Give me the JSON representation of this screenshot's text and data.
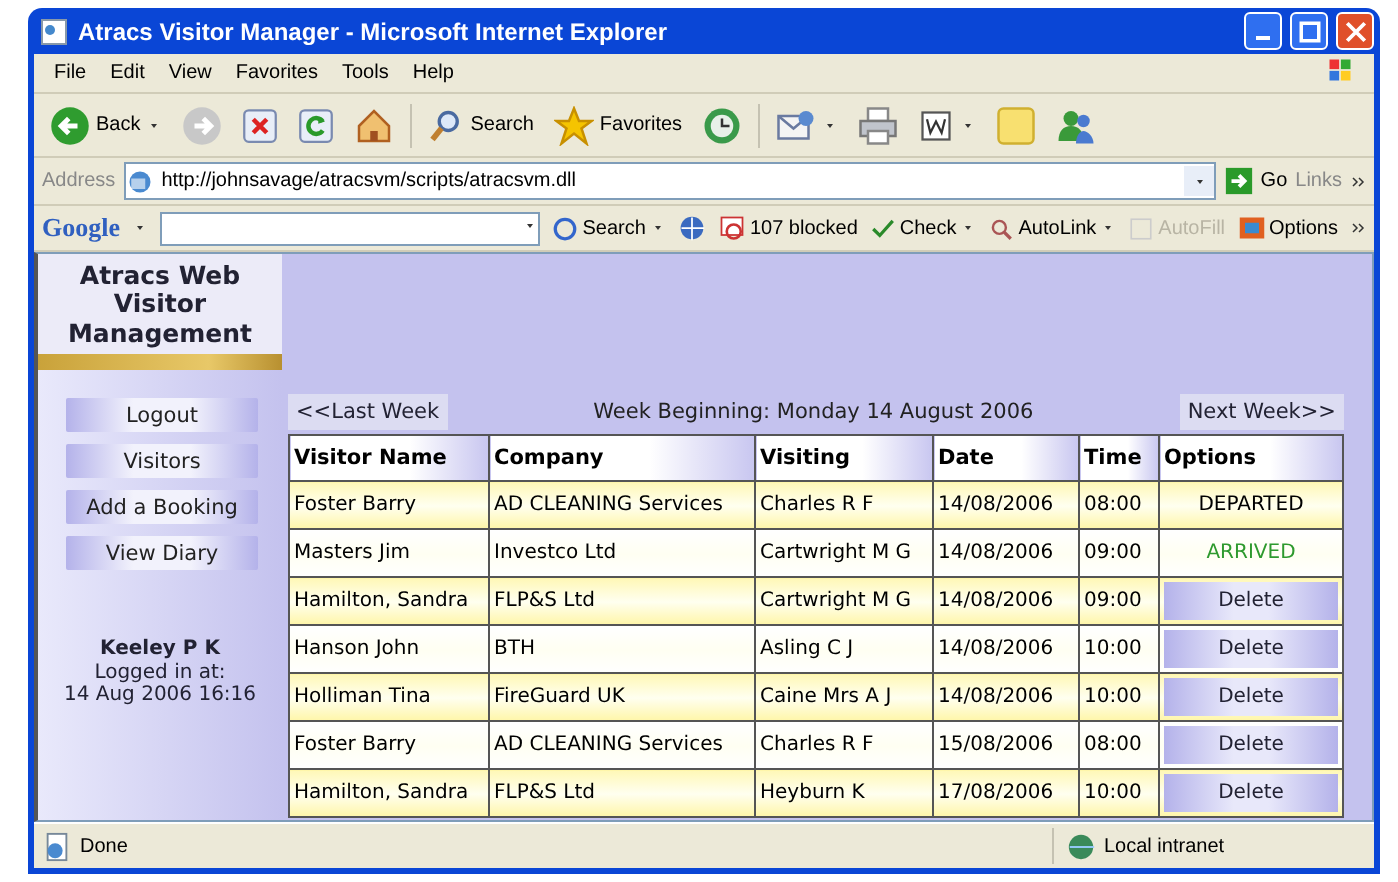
{
  "window": {
    "title": "Atracs Visitor Manager - Microsoft Internet Explorer"
  },
  "menu": [
    "File",
    "Edit",
    "View",
    "Favorites",
    "Tools",
    "Help"
  ],
  "toolbar": [
    {
      "kind": "back",
      "label": "Back"
    },
    {
      "kind": "forward"
    },
    {
      "kind": "stop"
    },
    {
      "kind": "refresh"
    },
    {
      "kind": "home"
    },
    {
      "kind": "search",
      "label": "Search"
    },
    {
      "kind": "favorites",
      "label": "Favorites"
    },
    {
      "kind": "history"
    },
    {
      "kind": "mail"
    },
    {
      "kind": "print"
    },
    {
      "kind": "edit"
    },
    {
      "kind": "notes"
    },
    {
      "kind": "messenger"
    }
  ],
  "address": {
    "label": "Address",
    "value": "http://johnsavage/atracsvm/scripts/atracsvm.dll",
    "go": "Go",
    "links": "Links"
  },
  "google_bar": {
    "logo": "Google",
    "search": "Search",
    "blocked": "107 blocked",
    "check": "Check",
    "autolink": "AutoLink",
    "autofill": {
      "label": "AutoFill",
      "disabled": true
    },
    "options": "Options"
  },
  "sidebar": {
    "title": "Atracs Web Visitor Management",
    "buttons": [
      "Logout",
      "Visitors",
      "Add a Booking",
      "View Diary"
    ],
    "user": "Keeley P K",
    "login_label": "Logged in at:",
    "login_time": "14 Aug 2006 16:16"
  },
  "week_nav": {
    "prev": "<<Last Week",
    "label": "Week Beginning: Monday 14 August 2006",
    "next": "Next Week>>"
  },
  "table": {
    "columns": [
      "Visitor Name",
      "Company",
      "Visiting",
      "Date",
      "Time",
      "Options"
    ],
    "rows": [
      {
        "cells": [
          "Foster Barry",
          "AD CLEANING Services",
          "Charles R F",
          "14/08/2006",
          "08:00"
        ],
        "option": {
          "kind": "status",
          "text": "DEPARTED",
          "color": "#000000"
        }
      },
      {
        "cells": [
          "Masters Jim",
          "Investco Ltd",
          "Cartwright M G",
          "14/08/2006",
          "09:00"
        ],
        "option": {
          "kind": "status",
          "text": "ARRIVED",
          "color": "#2e9a2e"
        }
      },
      {
        "cells": [
          "Hamilton, Sandra",
          "FLP&S Ltd",
          "Cartwright M G",
          "14/08/2006",
          "09:00"
        ],
        "option": {
          "kind": "button",
          "text": "Delete"
        }
      },
      {
        "cells": [
          "Hanson John",
          "BTH",
          "Asling C J",
          "14/08/2006",
          "10:00"
        ],
        "option": {
          "kind": "button",
          "text": "Delete"
        }
      },
      {
        "cells": [
          "Holliman Tina",
          "FireGuard UK",
          "Caine Mrs A J",
          "14/08/2006",
          "10:00"
        ],
        "option": {
          "kind": "button",
          "text": "Delete"
        }
      },
      {
        "cells": [
          "Foster Barry",
          "AD CLEANING Services",
          "Charles R F",
          "15/08/2006",
          "08:00"
        ],
        "option": {
          "kind": "button",
          "text": "Delete"
        }
      },
      {
        "cells": [
          "Hamilton, Sandra",
          "FLP&S Ltd",
          "Heyburn K",
          "17/08/2006",
          "10:00"
        ],
        "option": {
          "kind": "button",
          "text": "Delete"
        }
      }
    ]
  },
  "status_bar": {
    "text": "Done",
    "zone": "Local intranet"
  }
}
